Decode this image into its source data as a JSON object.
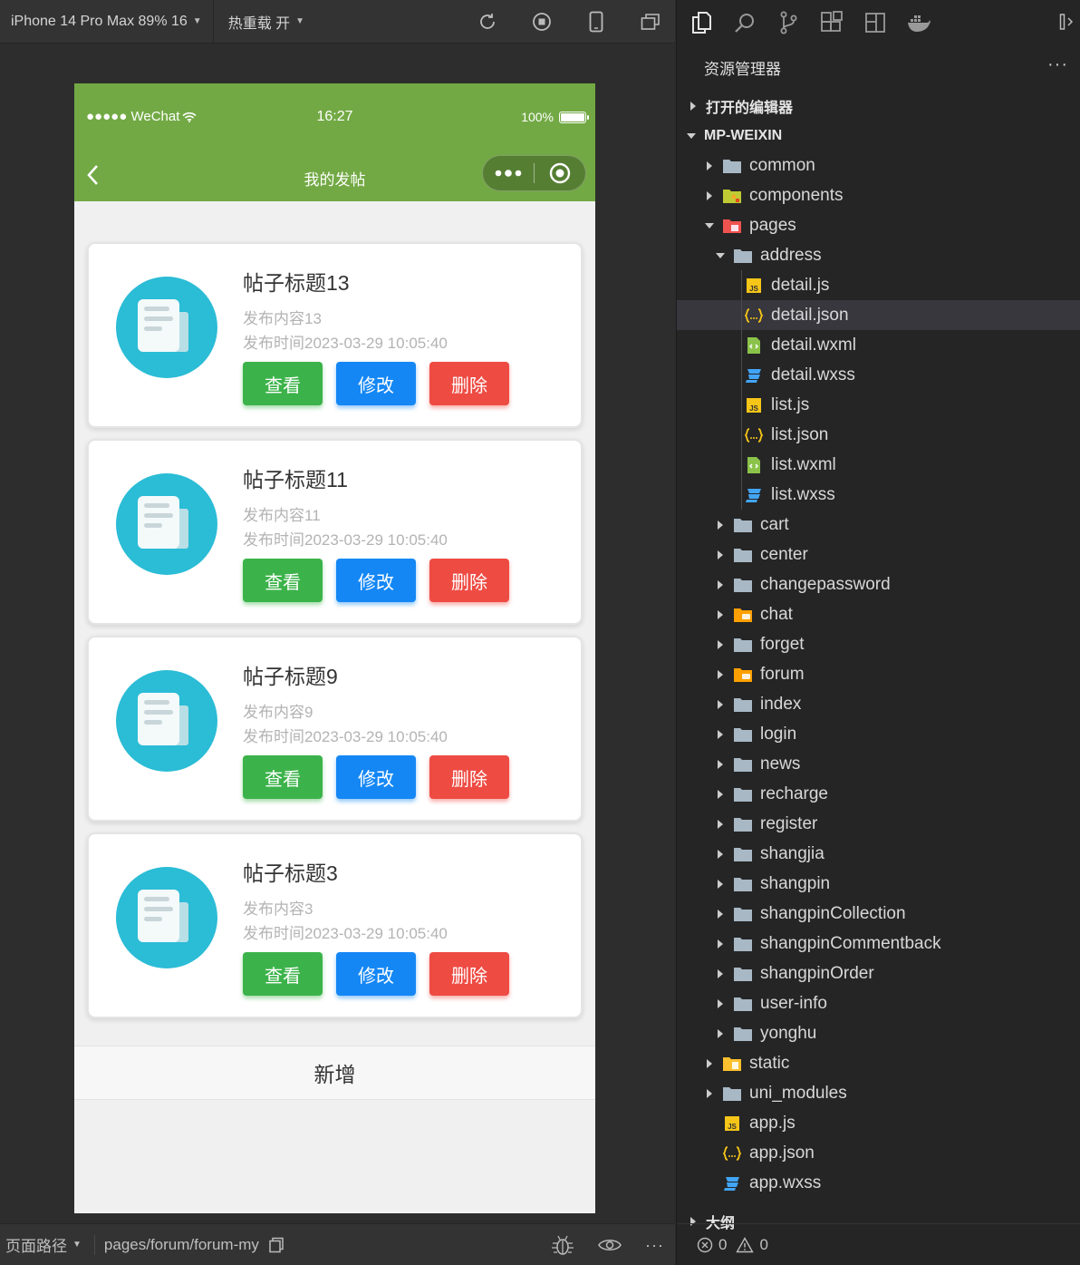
{
  "toolbar": {
    "device": "iPhone 14 Pro Max 89% 16",
    "hot_reload": "热重载 开"
  },
  "phone": {
    "carrier": "●●●●● WeChat",
    "time": "16:27",
    "battery": "100%",
    "battery_level": 1.0,
    "page_title": "我的发帖",
    "theme_color": "#72a944",
    "posts": [
      {
        "title": "帖子标题13",
        "content": "发布内容13",
        "date": "发布时间2023-03-29 10:05:40"
      },
      {
        "title": "帖子标题11",
        "content": "发布内容11",
        "date": "发布时间2023-03-29 10:05:40"
      },
      {
        "title": "帖子标题9",
        "content": "发布内容9",
        "date": "发布时间2023-03-29 10:05:40"
      },
      {
        "title": "帖子标题3",
        "content": "发布内容3",
        "date": "发布时间2023-03-29 10:05:40"
      }
    ],
    "buttons": {
      "view": "查看",
      "edit": "修改",
      "delete": "删除"
    },
    "add_label": "新增"
  },
  "sim_footer": {
    "path_label": "页面路径",
    "path": "pages/forum/forum-my"
  },
  "explorer": {
    "title": "资源管理器",
    "more": "···",
    "open_editors": "打开的编辑器",
    "project": "MP-WEIXIN",
    "outline": "大纲",
    "tree": [
      {
        "name": "common",
        "type": "folder",
        "depth": 1
      },
      {
        "name": "components",
        "type": "folder-components",
        "depth": 1
      },
      {
        "name": "pages",
        "type": "folder-pages",
        "depth": 1,
        "open": true
      },
      {
        "name": "address",
        "type": "folder",
        "depth": 2,
        "open": true
      },
      {
        "name": "detail.js",
        "type": "js",
        "depth": 3
      },
      {
        "name": "detail.json",
        "type": "json",
        "depth": 3,
        "selected": true
      },
      {
        "name": "detail.wxml",
        "type": "wxml",
        "depth": 3
      },
      {
        "name": "detail.wxss",
        "type": "wxss",
        "depth": 3
      },
      {
        "name": "list.js",
        "type": "js",
        "depth": 3
      },
      {
        "name": "list.json",
        "type": "json",
        "depth": 3
      },
      {
        "name": "list.wxml",
        "type": "wxml",
        "depth": 3
      },
      {
        "name": "list.wxss",
        "type": "wxss",
        "depth": 3
      },
      {
        "name": "cart",
        "type": "folder",
        "depth": 2
      },
      {
        "name": "center",
        "type": "folder",
        "depth": 2
      },
      {
        "name": "changepassword",
        "type": "folder",
        "depth": 2
      },
      {
        "name": "chat",
        "type": "folder-orange",
        "depth": 2
      },
      {
        "name": "forget",
        "type": "folder",
        "depth": 2
      },
      {
        "name": "forum",
        "type": "folder-orange",
        "depth": 2
      },
      {
        "name": "index",
        "type": "folder",
        "depth": 2
      },
      {
        "name": "login",
        "type": "folder",
        "depth": 2
      },
      {
        "name": "news",
        "type": "folder",
        "depth": 2
      },
      {
        "name": "recharge",
        "type": "folder",
        "depth": 2
      },
      {
        "name": "register",
        "type": "folder",
        "depth": 2
      },
      {
        "name": "shangjia",
        "type": "folder",
        "depth": 2
      },
      {
        "name": "shangpin",
        "type": "folder",
        "depth": 2
      },
      {
        "name": "shangpinCollection",
        "type": "folder",
        "depth": 2
      },
      {
        "name": "shangpinCommentback",
        "type": "folder",
        "depth": 2
      },
      {
        "name": "shangpinOrder",
        "type": "folder",
        "depth": 2
      },
      {
        "name": "user-info",
        "type": "folder",
        "depth": 2
      },
      {
        "name": "yonghu",
        "type": "folder",
        "depth": 2
      },
      {
        "name": "static",
        "type": "folder-static",
        "depth": 1
      },
      {
        "name": "uni_modules",
        "type": "folder",
        "depth": 1
      },
      {
        "name": "app.js",
        "type": "js",
        "depth": 1
      },
      {
        "name": "app.json",
        "type": "json",
        "depth": 1
      },
      {
        "name": "app.wxss",
        "type": "wxss",
        "depth": 1
      }
    ]
  },
  "problems": {
    "errors": "0",
    "warnings": "0"
  }
}
